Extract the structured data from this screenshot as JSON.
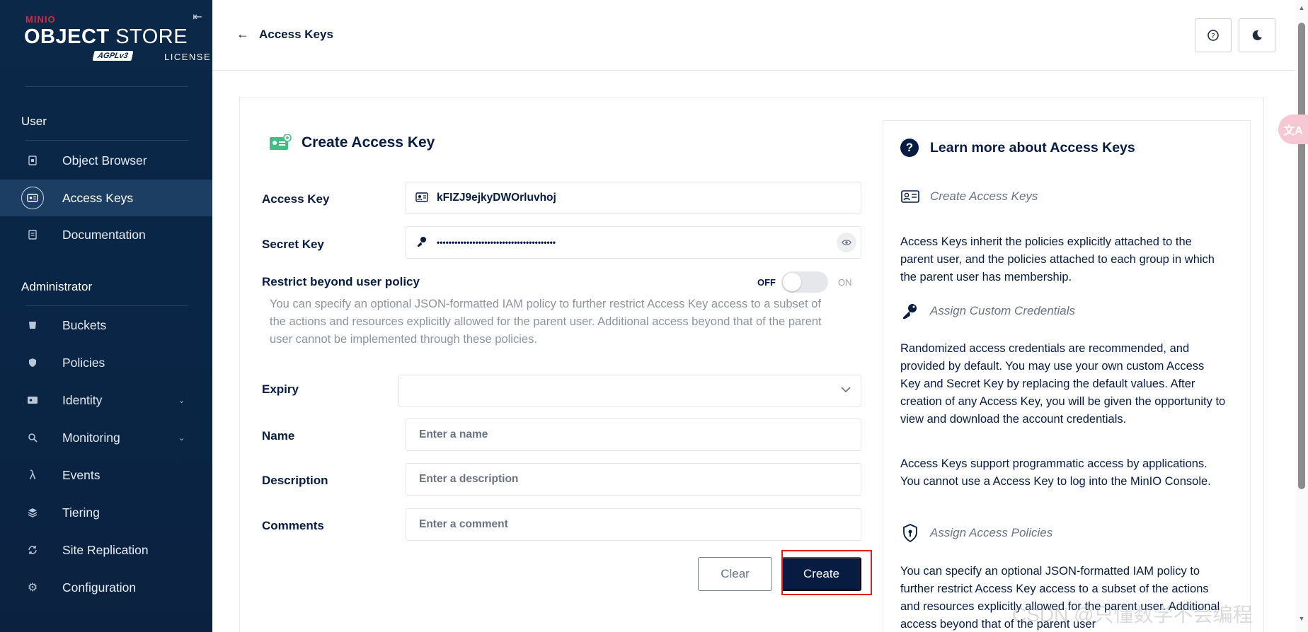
{
  "sidebar": {
    "logo": {
      "brand": "MINIO",
      "product_bold": "OBJECT",
      "product_rest": "STORE",
      "agpl": "AGPLv3",
      "license": "LICENSE"
    },
    "sections": [
      {
        "title": "User"
      },
      {
        "title": "Administrator"
      }
    ],
    "user_items": [
      {
        "label": "Object Browser",
        "icon": "object-browser-icon"
      },
      {
        "label": "Access Keys",
        "icon": "access-keys-icon",
        "active": true
      },
      {
        "label": "Documentation",
        "icon": "documentation-icon"
      }
    ],
    "admin_items": [
      {
        "label": "Buckets",
        "icon": "buckets-icon"
      },
      {
        "label": "Policies",
        "icon": "policies-icon"
      },
      {
        "label": "Identity",
        "icon": "identity-icon",
        "expandable": true
      },
      {
        "label": "Monitoring",
        "icon": "monitoring-icon",
        "expandable": true
      },
      {
        "label": "Events",
        "icon": "events-icon"
      },
      {
        "label": "Tiering",
        "icon": "tiering-icon"
      },
      {
        "label": "Site Replication",
        "icon": "site-replication-icon"
      },
      {
        "label": "Configuration",
        "icon": "configuration-icon"
      }
    ]
  },
  "header": {
    "back_label": "Access Keys",
    "help_icon": "help-circle-icon",
    "theme_icon": "moon-icon"
  },
  "form": {
    "title": "Create Access Key",
    "access_key_label": "Access Key",
    "access_key_value": "kFIZJ9ejkyDWOrluvhoj",
    "secret_key_label": "Secret Key",
    "secret_key_mask": "••••••••••••••••••••••••••••••••••••••••",
    "restrict_label": "Restrict beyond user policy",
    "toggle_off": "OFF",
    "toggle_on": "ON",
    "restrict_help": "You can specify an optional JSON-formatted IAM policy to further restrict Access Key access to a subset of the actions and resources explicitly allowed for the parent user. Additional access beyond that of the parent user cannot be implemented through these policies.",
    "expiry_label": "Expiry",
    "expiry_value": "",
    "name_label": "Name",
    "name_placeholder": "Enter a name",
    "description_label": "Description",
    "description_placeholder": "Enter a description",
    "comments_label": "Comments",
    "comments_placeholder": "Enter a comment",
    "clear_label": "Clear",
    "create_label": "Create"
  },
  "help": {
    "title": "Learn more about Access Keys",
    "section1_title": "Create Access Keys",
    "section1_p1": "Access Keys inherit the policies explicitly attached to the parent user, and the policies attached to each group in which the parent user has membership.",
    "section2_title": "Assign Custom Credentials",
    "section2_p1": "Randomized access credentials are recommended, and provided by default. You may use your own custom Access Key and Secret Key by replacing the default values. After creation of any Access Key, you will be given the opportunity to view and download the account credentials.",
    "section2_p2": "Access Keys support programmatic access by applications. You cannot use a Access Key to log into the MinIO Console.",
    "section3_title": "Assign Access Policies",
    "section3_p1": "You can specify an optional JSON-formatted IAM policy to further restrict Access Key access to a subset of the actions and resources explicitly allowed for the parent user. Additional access beyond that of the parent user"
  },
  "watermark": "CSDN @只懂数学不会编程",
  "translate_badge": "文A"
}
